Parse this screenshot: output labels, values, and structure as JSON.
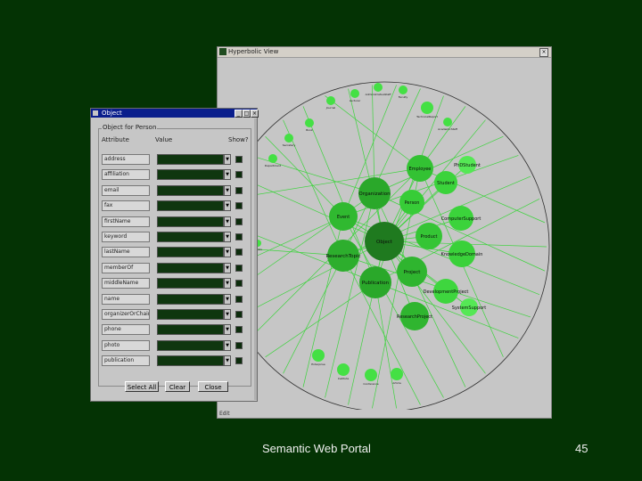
{
  "hyperbolic_view": {
    "title": "Hyperbolic View",
    "close": "×",
    "status": "Edit",
    "nodes_large": [
      {
        "id": "object",
        "label": "Object"
      },
      {
        "id": "employee",
        "label": "Employee"
      },
      {
        "id": "organization",
        "label": "Organization"
      },
      {
        "id": "person",
        "label": "Person"
      },
      {
        "id": "event",
        "label": "Event"
      },
      {
        "id": "product",
        "label": "Product"
      },
      {
        "id": "research_topic",
        "label": "ResearchTopic"
      },
      {
        "id": "project",
        "label": "Project"
      },
      {
        "id": "publication",
        "label": "Publication"
      },
      {
        "id": "student",
        "label": "Student"
      },
      {
        "id": "computer_support",
        "label": "ComputerSupport"
      },
      {
        "id": "knowledge_domain",
        "label": "KnowledgeDomain"
      },
      {
        "id": "development_project",
        "label": "DevelopmentProject"
      },
      {
        "id": "research_project",
        "label": "ResearchProject"
      },
      {
        "id": "phd_student",
        "label": "PhDStudent"
      },
      {
        "id": "system_support",
        "label": "SystemSupport"
      }
    ],
    "nodes_small": [
      {
        "id": "s1",
        "label": "Lecturer"
      },
      {
        "id": "s2",
        "label": "AdministrativeStaff"
      },
      {
        "id": "s3",
        "label": "Faculty"
      },
      {
        "id": "s4",
        "label": "Journal"
      },
      {
        "id": "s5",
        "label": "Book"
      },
      {
        "id": "s6",
        "label": "TechnicalReport"
      },
      {
        "id": "s7",
        "label": "AcademicStaff"
      },
      {
        "id": "s8",
        "label": "Secretary"
      },
      {
        "id": "s9",
        "label": "Department"
      },
      {
        "id": "s10",
        "label": "Enterprise"
      },
      {
        "id": "s11",
        "label": "Institute"
      },
      {
        "id": "s12",
        "label": "Conference"
      },
      {
        "id": "s13",
        "label": "Article"
      },
      {
        "id": "s14",
        "label": "Thesis"
      }
    ]
  },
  "object_finder": {
    "title": "Object",
    "min": "_",
    "max": "□",
    "close": "×",
    "group_label": "Object for Person",
    "columns": {
      "attribute": "Attribute",
      "value": "Value",
      "show": "Show?"
    },
    "rows": [
      {
        "label": "address"
      },
      {
        "label": "affiliation"
      },
      {
        "label": "email"
      },
      {
        "label": "fax"
      },
      {
        "label": "firstName"
      },
      {
        "label": "keyword"
      },
      {
        "label": "lastName"
      },
      {
        "label": "memberOf"
      },
      {
        "label": "middleName"
      },
      {
        "label": "name"
      },
      {
        "label": "organizerOrChairOf"
      },
      {
        "label": "phone"
      },
      {
        "label": "photo"
      },
      {
        "label": "publication"
      }
    ],
    "buttons": {
      "select_all": "Select All",
      "clear": "Clear",
      "close": "Close"
    }
  },
  "footer": {
    "title": "Semantic Web Portal",
    "slide_number": "45"
  },
  "colors": {
    "background": "#043304",
    "node_dark": "#1f7a1f",
    "node_mid": "#2fbf2f",
    "node_light": "#44e044",
    "edge": "#3ed33e"
  }
}
